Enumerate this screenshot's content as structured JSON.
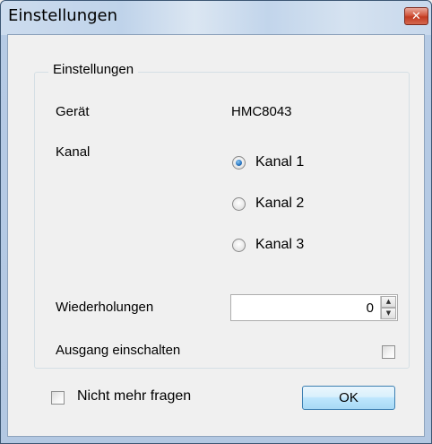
{
  "window": {
    "title": "Einstellungen"
  },
  "group": {
    "legend": "Einstellungen"
  },
  "device": {
    "label": "Gerät",
    "value": "HMC8043"
  },
  "channel": {
    "label": "Kanal",
    "options": [
      {
        "label": "Kanal 1",
        "checked": true
      },
      {
        "label": "Kanal 2",
        "checked": false
      },
      {
        "label": "Kanal 3",
        "checked": false
      }
    ]
  },
  "repetitions": {
    "label": "Wiederholungen",
    "value": "0"
  },
  "output": {
    "label": "Ausgang einschalten",
    "checked": false
  },
  "footer": {
    "dont_ask_label": "Nicht mehr fragen",
    "dont_ask_checked": false,
    "ok_label": "OK"
  },
  "icons": {
    "close": "close-icon",
    "spin_up": "arrow-up-icon",
    "spin_down": "arrow-down-icon"
  }
}
